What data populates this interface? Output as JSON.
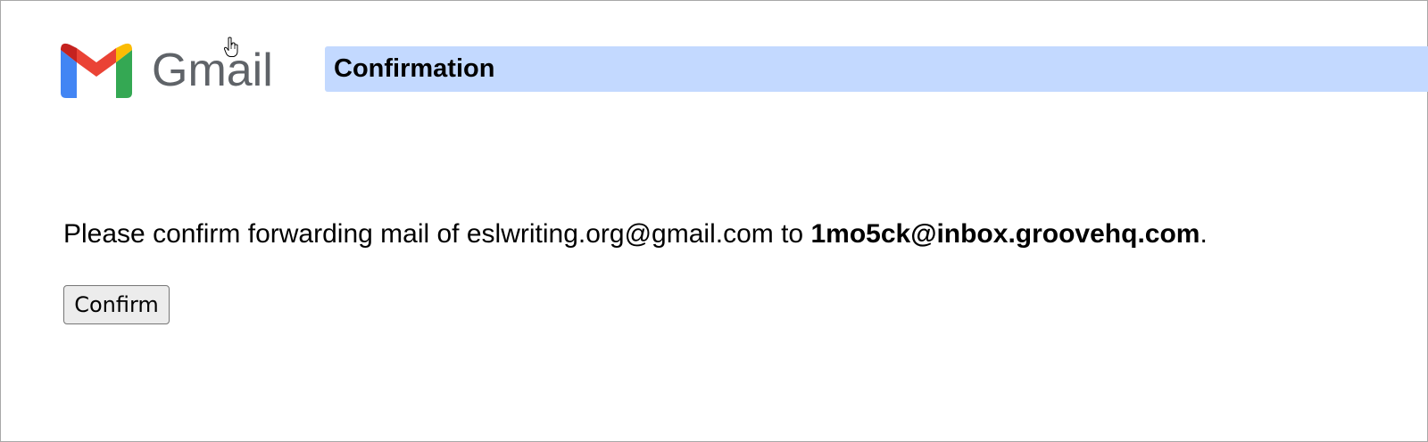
{
  "logo": {
    "wordmark": "Gmail",
    "icon": "gmail-m-logo",
    "colors": {
      "red": "#ea4335",
      "dark_red": "#c5221f",
      "blue": "#4285f4",
      "green": "#34a853",
      "yellow": "#fbbc04",
      "wordmark": "#5f6368"
    }
  },
  "header": {
    "title": "Confirmation",
    "bar_color": "#c3d9ff"
  },
  "message": {
    "prefix": "Please confirm forwarding mail of ",
    "from_address": "eslwriting.org@gmail.com",
    "middle": " to ",
    "to_address": "1mo5ck@inbox.groovehq.com",
    "suffix": "."
  },
  "confirm_button": {
    "label": "Confirm"
  },
  "cursor": {
    "icon": "hand-pointer-icon"
  }
}
